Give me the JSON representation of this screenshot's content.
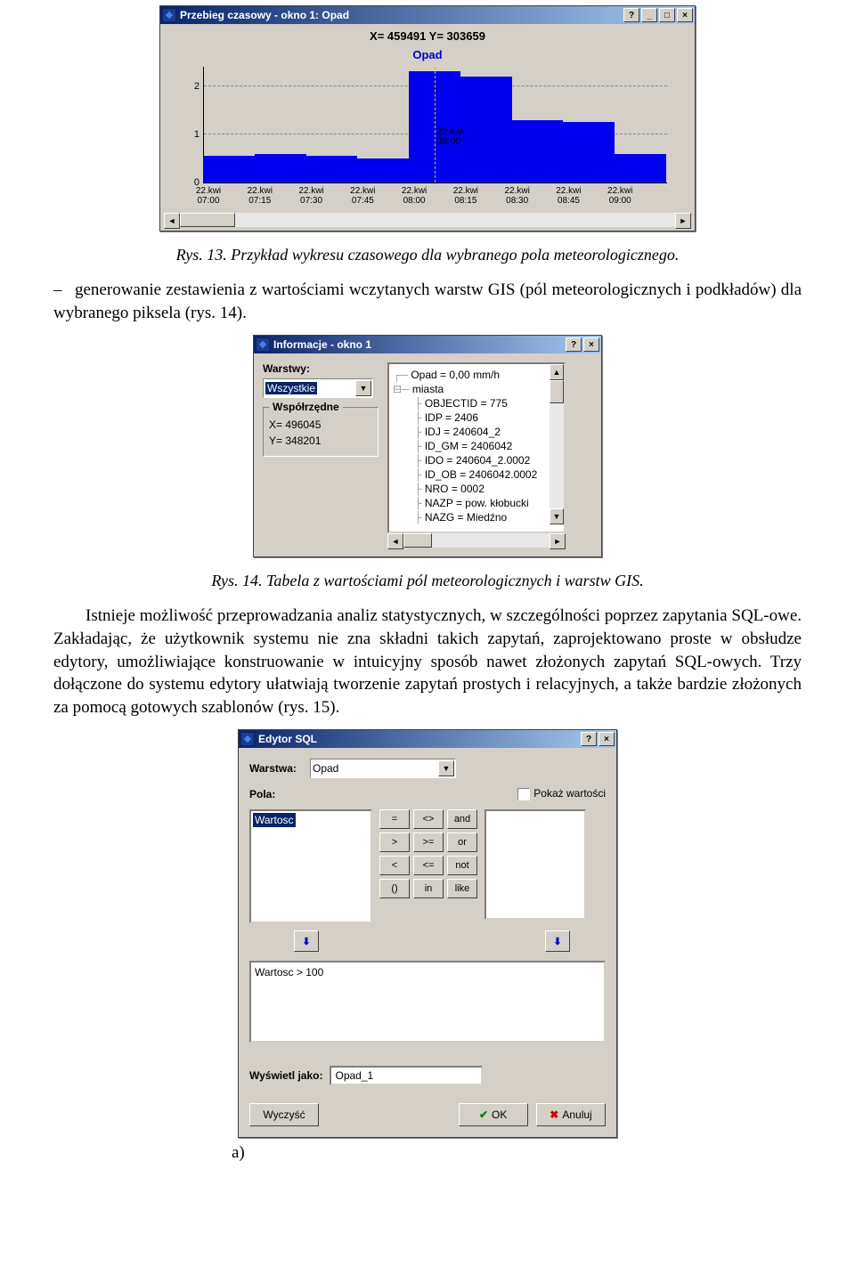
{
  "win1": {
    "title": "Przebieg czasowy - okno 1: Opad",
    "coord": "X= 459491   Y= 303659",
    "chart_title": "Opad",
    "marker": {
      "date": "22.kwi",
      "time": "08:00"
    }
  },
  "chart_data": {
    "type": "bar",
    "title": "Opad",
    "xlabel": "",
    "ylabel": "",
    "ylim": [
      0,
      2.4
    ],
    "categories": [
      "22.kwi 07:00",
      "22.kwi 07:15",
      "22.kwi 07:30",
      "22.kwi 07:45",
      "22.kwi 08:00",
      "22.kwi 08:15",
      "22.kwi 08:30",
      "22.kwi 08:45",
      "22.kwi 09:00"
    ],
    "x_tick_labels": [
      {
        "line1": "22.kwi",
        "line2": "07:00"
      },
      {
        "line1": "22.kwi",
        "line2": "07:15"
      },
      {
        "line1": "22.kwi",
        "line2": "07:30"
      },
      {
        "line1": "22.kwi",
        "line2": "07:45"
      },
      {
        "line1": "22.kwi",
        "line2": "08:00"
      },
      {
        "line1": "22.kwi",
        "line2": "08:15"
      },
      {
        "line1": "22.kwi",
        "line2": "08:30"
      },
      {
        "line1": "22.kwi",
        "line2": "08:45"
      },
      {
        "line1": "22.kwi",
        "line2": "09:00"
      }
    ],
    "y_ticks": [
      0,
      1,
      2
    ],
    "values": [
      0.55,
      0.6,
      0.55,
      0.5,
      2.3,
      2.2,
      1.3,
      1.25,
      0.6
    ]
  },
  "caption1": "Rys. 13. Przykład wykresu czasowego dla wybranego pola meteorologicznego.",
  "bullet1": "generowanie zestawienia z wartościami wczytanych warstw GIS (pól meteorologicznych i podkładów) dla wybranego piksela (rys. 14).",
  "win2": {
    "title": "Informacje - okno 1",
    "layers_label": "Warstwy:",
    "layers_value": "Wszystkie",
    "coord_group": "Współrzędne",
    "x": "X= 496045",
    "y": "Y= 348201",
    "tree": [
      "Opad = 0,00 mm/h",
      "miasta",
      "OBJECTID = 775",
      "IDP = 2406",
      "IDJ = 240604_2",
      "ID_GM = 2406042",
      "IDO = 240604_2.0002",
      "ID_OB = 2406042.0002",
      "NRO = 0002",
      "NAZP = pow. kłobucki",
      "NAZG = Miedźno"
    ]
  },
  "caption2": "Rys. 14. Tabela z wartościami pól meteorologicznych i warstw GIS.",
  "para1": "Istnieje możliwość przeprowadzania analiz statystycznych, w szczególności poprzez zapytania SQL-owe. Zakładając, że użytkownik systemu nie zna składni takich zapytań, zaprojektowano proste w obsłudze edytory, umożliwiające konstruowanie w intuicyjny sposób nawet złożonych zapytań SQL-owych. Trzy dołączone do systemu edytory ułatwiają tworzenie zapytań prostych i relacyjnych, a także bardzie złożonych za pomocą gotowych szablonów (rys. 15).",
  "win3": {
    "title": "Edytor SQL",
    "layer_label": "Warstwa:",
    "layer_value": "Opad",
    "fields_label": "Pola:",
    "show_vals": "Pokaż wartości",
    "field_item": "Wartosc",
    "ops": [
      "=",
      "<>",
      "and",
      ">",
      ">=",
      "or",
      "<",
      "<=",
      "not",
      "()",
      "in",
      "like"
    ],
    "sql": "Wartosc > 100",
    "display_label": "Wyświetl jako:",
    "display_value": "Opad_1",
    "btn_clear": "Wyczyść",
    "btn_ok": "OK",
    "btn_cancel": "Anuluj"
  },
  "label_a": "a)"
}
